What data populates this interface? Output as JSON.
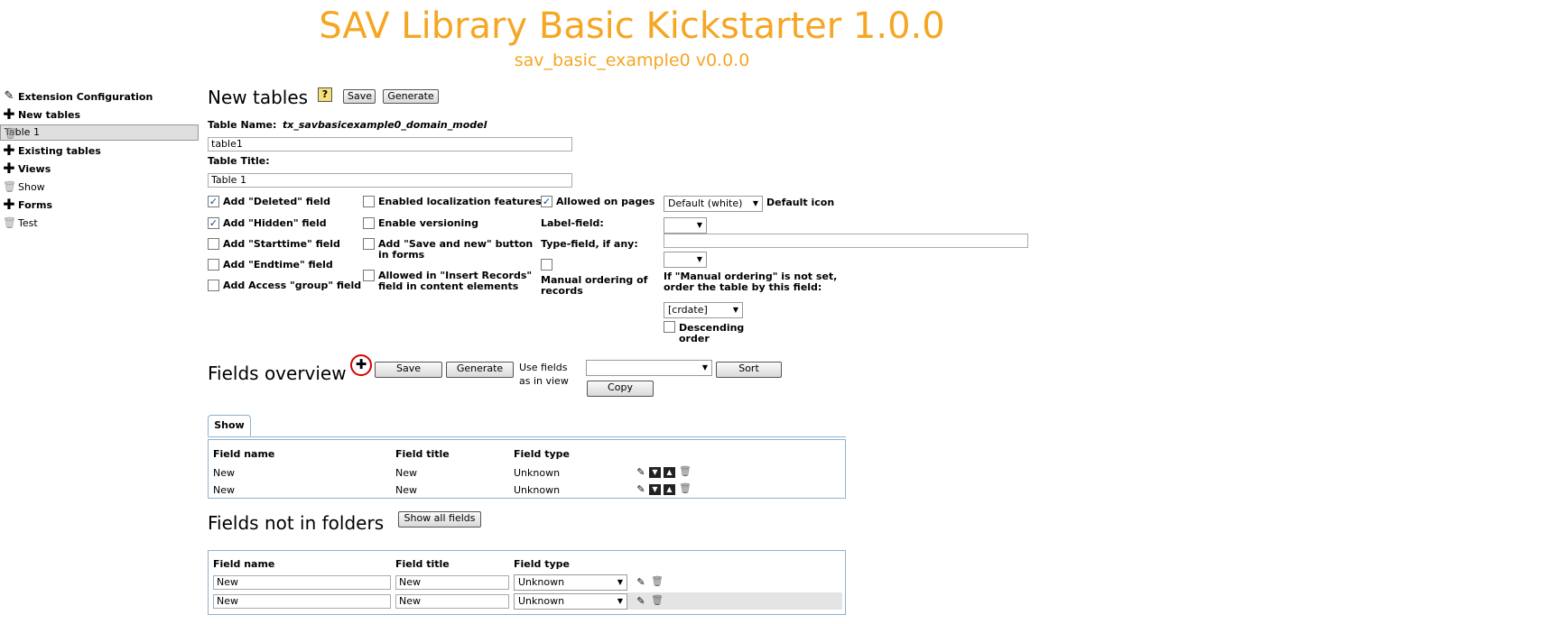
{
  "header": {
    "title": "SAV Library Basic Kickstarter 1.0.0",
    "subtitle": "sav_basic_example0 v0.0.0"
  },
  "sidebar": {
    "items": [
      {
        "label": "Extension Configuration",
        "icon": "pencil-icon",
        "bold": true
      },
      {
        "label": "New tables",
        "icon": "plus-icon",
        "bold": true
      },
      {
        "label": "Table 1",
        "icon": "trash-icon",
        "bold": false,
        "selected": true
      },
      {
        "label": "Existing tables",
        "icon": "plus-icon",
        "bold": true
      },
      {
        "label": "Views",
        "icon": "plus-icon",
        "bold": true
      },
      {
        "label": "Show",
        "icon": "trash-icon",
        "bold": false
      },
      {
        "label": "Forms",
        "icon": "plus-icon",
        "bold": true
      },
      {
        "label": "Test",
        "icon": "trash-icon",
        "bold": false
      }
    ]
  },
  "new_tables": {
    "heading": "New tables",
    "help_icon": "help-icon",
    "save_label": "Save",
    "generate_label": "Generate",
    "table_name_label": "Table Name:",
    "table_name_value": "tx_savbasicexample0_domain_model",
    "table_name_input": "table1",
    "table_title_label": "Table Title:",
    "table_title_input": "Table 1",
    "col1": [
      {
        "label": "Add \"Deleted\" field",
        "checked": true
      },
      {
        "label": "Add \"Hidden\" field",
        "checked": true
      },
      {
        "label": "Add \"Starttime\" field",
        "checked": false
      },
      {
        "label": "Add \"Endtime\" field",
        "checked": false
      },
      {
        "label": "Add Access \"group\" field",
        "checked": false
      }
    ],
    "col2": [
      {
        "label": "Enabled localization features",
        "checked": false
      },
      {
        "label": "Enable versioning",
        "checked": false
      },
      {
        "label": "Add \"Save and new\" button",
        "label2": "in forms",
        "checked": false
      },
      {
        "label": "Allowed in \"Insert Records\"",
        "label2": "field in content elements",
        "checked": false
      }
    ],
    "allowed_on_pages_label": "Allowed on pages",
    "allowed_on_pages_checked": true,
    "label_field_label": "Label-field:",
    "type_field_label": "Type-field, if any:",
    "manual_ordering_label": "Manual ordering of",
    "manual_ordering_label2": "records",
    "default_icon_select": "Default (white)",
    "default_icon_label": "Default icon",
    "order_note_1": "If \"Manual ordering\" is not set,",
    "order_note_2": "order the table by this field:",
    "order_select": "[crdate]",
    "descending_label": "Descending",
    "descending_label2": "order"
  },
  "fields_overview": {
    "heading": "Fields overview",
    "save_label": "Save",
    "generate_label": "Generate",
    "use_fields_label_1": "Use fields",
    "use_fields_label_2": "as in view",
    "sort_label": "Sort",
    "copy_label": "Copy",
    "tab_label": "Show",
    "columns": [
      "Field name",
      "Field title",
      "Field type"
    ],
    "rows": [
      {
        "name": "New",
        "title": "New",
        "type": "Unknown"
      },
      {
        "name": "New",
        "title": "New",
        "type": "Unknown"
      }
    ]
  },
  "fields_not_in_folders": {
    "heading": "Fields not in folders",
    "show_all_label": "Show all fields",
    "columns": [
      "Field name",
      "Field title",
      "Field type"
    ],
    "rows": [
      {
        "name": "New",
        "title": "New",
        "type": "Unknown"
      },
      {
        "name": "New",
        "title": "New",
        "type": "Unknown"
      }
    ]
  }
}
